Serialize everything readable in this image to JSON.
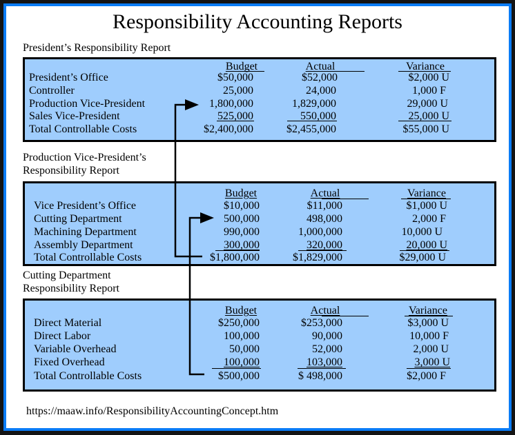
{
  "title": "Responsibility Accounting Reports",
  "colors": {
    "frame": "#0a7cf6",
    "box_fill": "#9fcdfd",
    "outer": "#141414"
  },
  "columns": {
    "budget": "Budget",
    "actual": "Actual",
    "variance": "Variance"
  },
  "reports": [
    {
      "label_lines": [
        "President’s Responsibility Report"
      ],
      "rows": [
        {
          "label": "President’s Office",
          "budget": "$50,000",
          "actual": "$52,000",
          "variance": "$2,000 U"
        },
        {
          "label": "Controller",
          "budget": "25,000",
          "actual": "24,000",
          "variance": "1,000 F"
        },
        {
          "label": "Production Vice-President",
          "budget": "1,800,000",
          "actual": "1,829,000",
          "variance": "29,000 U"
        },
        {
          "label": "Sales Vice-President",
          "budget": "525,000",
          "actual": "550,000",
          "variance": "25,000 U"
        },
        {
          "label": "Total Controllable Costs",
          "budget": "$2,400,000",
          "actual": "$2,455,000",
          "variance": "$55,000 U"
        }
      ]
    },
    {
      "label_lines": [
        "Production Vice-President’s",
        "Responsibility Report"
      ],
      "rows": [
        {
          "label": "Vice President’s Office",
          "budget": "$10,000",
          "actual": "$11,000",
          "variance": "$1,000 U"
        },
        {
          "label": "Cutting Department",
          "budget": "500,000",
          "actual": "498,000",
          "variance": "2,000 F"
        },
        {
          "label": "Machining Department",
          "budget": "990,000",
          "actual": "1,000,000",
          "variance": "10,000 U"
        },
        {
          "label": "Assembly Department",
          "budget": "300,000",
          "actual": "320,000",
          "variance": "20,000 U"
        },
        {
          "label": "Total Controllable Costs",
          "budget": "$1,800,000",
          "actual": "$1,829,000",
          "variance": "$29,000 U"
        }
      ]
    },
    {
      "label_lines": [
        "Cutting Department",
        "Responsibility Report"
      ],
      "rows": [
        {
          "label": "Direct Material",
          "budget": "$250,000",
          "actual": "$253,000",
          "variance": "$3,000 U"
        },
        {
          "label": "Direct Labor",
          "budget": "100,000",
          "actual": "90,000",
          "variance": "10,000 F"
        },
        {
          "label": "Variable Overhead",
          "budget": "50,000",
          "actual": "52,000",
          "variance": "2,000 U"
        },
        {
          "label": "Fixed Overhead",
          "budget": "100,000",
          "actual": "103,000",
          "variance": "3,000 U"
        },
        {
          "label": "Total Controllable Costs",
          "budget": "$500,000",
          "actual": "$ 498,000",
          "variance": "$2,000 F"
        }
      ]
    }
  ],
  "footer_url": "https://maaw.info/ResponsibilityAccountingConcept.htm"
}
